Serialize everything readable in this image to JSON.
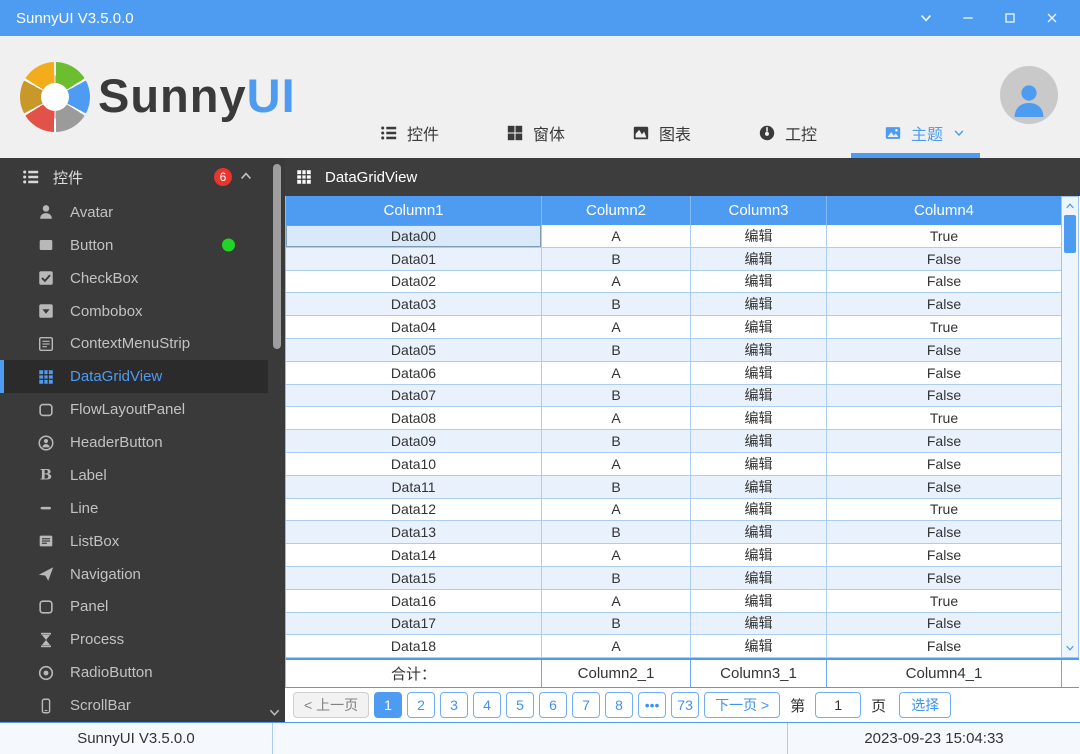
{
  "window": {
    "title": "SunnyUI V3.5.0.0",
    "controls": {
      "dropdown": "chevron-down-icon",
      "minimize": "minimize-icon",
      "maximize": "maximize-icon",
      "close": "close-icon"
    }
  },
  "brand": {
    "name_primary": "Sunny",
    "name_secondary": "UI",
    "wheel_colors": [
      "#f2ac1c",
      "#6cbd2f",
      "#4e9bf2",
      "#9b9b9b",
      "#e25248",
      "#c8982a"
    ]
  },
  "nav": {
    "tabs": [
      {
        "label": "控件",
        "icon": "list-icon",
        "active": false
      },
      {
        "label": "窗体",
        "icon": "windows-icon",
        "active": false
      },
      {
        "label": "图表",
        "icon": "chart-icon",
        "active": false
      },
      {
        "label": "工控",
        "icon": "gauge-icon",
        "active": false
      },
      {
        "label": "主题",
        "icon": "image-icon",
        "active": true,
        "has_dropdown": true
      }
    ]
  },
  "sidebar": {
    "header": {
      "label": "控件",
      "badge": "6"
    },
    "items": [
      {
        "label": "Avatar",
        "icon": "avatar-icon"
      },
      {
        "label": "Button",
        "icon": "button-icon",
        "dot": true
      },
      {
        "label": "CheckBox",
        "icon": "checkbox-icon"
      },
      {
        "label": "Combobox",
        "icon": "combobox-icon"
      },
      {
        "label": "ContextMenuStrip",
        "icon": "contextmenu-icon"
      },
      {
        "label": "DataGridView",
        "icon": "datagrid-icon",
        "selected": true
      },
      {
        "label": "FlowLayoutPanel",
        "icon": "flowlayout-icon"
      },
      {
        "label": "HeaderButton",
        "icon": "headerbutton-icon"
      },
      {
        "label": "Label",
        "icon": "label-icon"
      },
      {
        "label": "Line",
        "icon": "line-icon"
      },
      {
        "label": "ListBox",
        "icon": "listbox-icon"
      },
      {
        "label": "Navigation",
        "icon": "navigation-icon"
      },
      {
        "label": "Panel",
        "icon": "panel-icon"
      },
      {
        "label": "Process",
        "icon": "process-icon"
      },
      {
        "label": "RadioButton",
        "icon": "radiobutton-icon"
      },
      {
        "label": "ScrollBar",
        "icon": "scrollbar-icon"
      }
    ]
  },
  "panel": {
    "title": "DataGridView"
  },
  "grid": {
    "columns": [
      "Column1",
      "Column2",
      "Column3",
      "Column4"
    ],
    "rows": [
      [
        "Data00",
        "A",
        "编辑",
        "True"
      ],
      [
        "Data01",
        "B",
        "编辑",
        "False"
      ],
      [
        "Data02",
        "A",
        "编辑",
        "False"
      ],
      [
        "Data03",
        "B",
        "编辑",
        "False"
      ],
      [
        "Data04",
        "A",
        "编辑",
        "True"
      ],
      [
        "Data05",
        "B",
        "编辑",
        "False"
      ],
      [
        "Data06",
        "A",
        "编辑",
        "False"
      ],
      [
        "Data07",
        "B",
        "编辑",
        "False"
      ],
      [
        "Data08",
        "A",
        "编辑",
        "True"
      ],
      [
        "Data09",
        "B",
        "编辑",
        "False"
      ],
      [
        "Data10",
        "A",
        "编辑",
        "False"
      ],
      [
        "Data11",
        "B",
        "编辑",
        "False"
      ],
      [
        "Data12",
        "A",
        "编辑",
        "True"
      ],
      [
        "Data13",
        "B",
        "编辑",
        "False"
      ],
      [
        "Data14",
        "A",
        "编辑",
        "False"
      ],
      [
        "Data15",
        "B",
        "编辑",
        "False"
      ],
      [
        "Data16",
        "A",
        "编辑",
        "True"
      ],
      [
        "Data17",
        "B",
        "编辑",
        "False"
      ],
      [
        "Data18",
        "A",
        "编辑",
        "False"
      ]
    ],
    "selected_cell": {
      "row": 0,
      "col": 0
    },
    "summary": [
      "合计：",
      "Column2_1",
      "Column3_1",
      "Column4_1"
    ]
  },
  "pagination": {
    "prev_label": "< 上一页",
    "next_label": "下一页 >",
    "pages": [
      "1",
      "2",
      "3",
      "4",
      "5",
      "6",
      "7",
      "8",
      "•••",
      "73"
    ],
    "active_page": "1",
    "jump_prefix": "第",
    "jump_value": "1",
    "jump_suffix": "页",
    "select_label": "选择"
  },
  "statusbar": {
    "left": "SunnyUI V3.5.0.0",
    "right": "2023-09-23 15:04:33"
  },
  "colors": {
    "accent_blue": "#4e9bf2",
    "sidebar_dark": "#3a3a3a",
    "badge_red": "#e8352e",
    "status_green": "#21d527",
    "row_alt_blue": "#e9f2fc"
  }
}
